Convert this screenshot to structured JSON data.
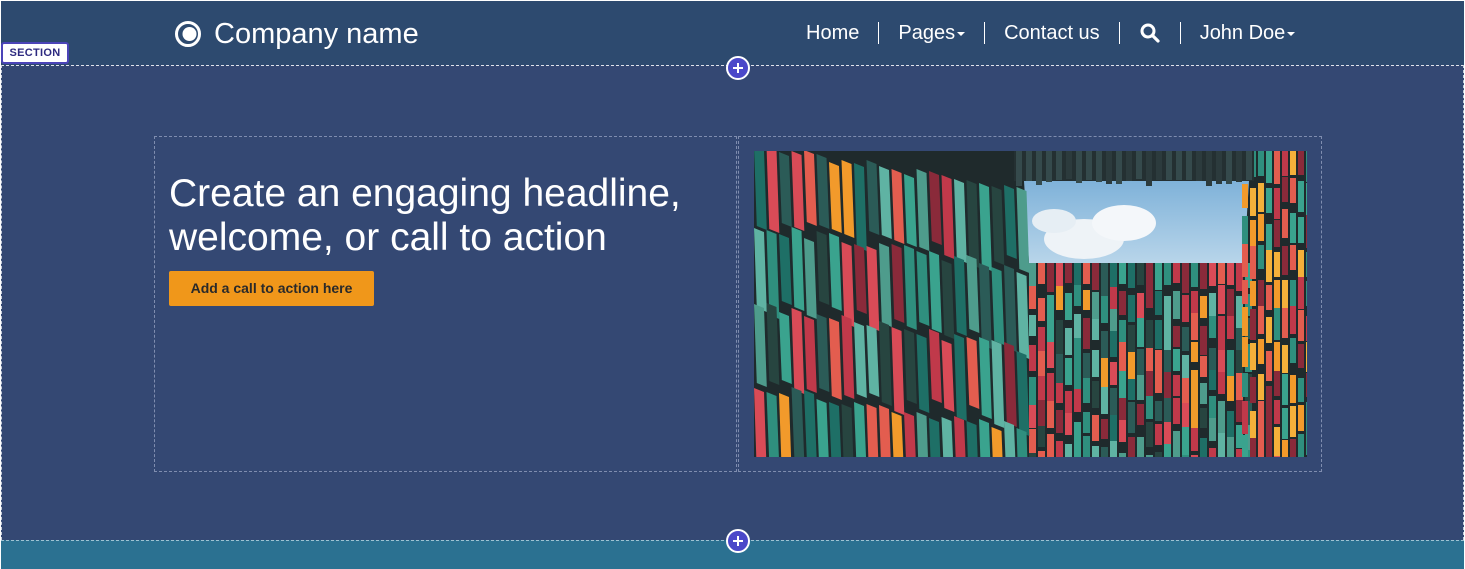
{
  "header": {
    "brand_name": "Company name",
    "brand_icon": "company-logo-icon",
    "nav": {
      "home": "Home",
      "pages": "Pages",
      "contact": "Contact us",
      "search_icon": "search-icon",
      "user": "John Doe"
    }
  },
  "section": {
    "tag_label": "SECTION",
    "headline": "Create an engaging headline, welcome, or call to action",
    "cta_label": "Add a call to action here",
    "image_icon": "colorful-building-photo"
  },
  "editor": {
    "add_section_icon": "plus-icon"
  },
  "colors": {
    "header_bg": "#2d4a6f",
    "section_bg": "#344873",
    "cta_bg": "#f0971a",
    "bottom_band_bg": "#2b7191",
    "accent": "#4b48c9"
  }
}
